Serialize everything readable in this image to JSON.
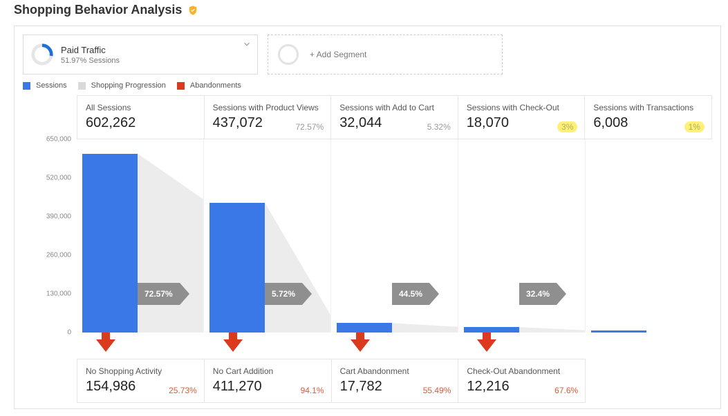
{
  "title": "Shopping Behavior Analysis",
  "segment": {
    "name": "Paid Traffic",
    "sub": "51.97% Sessions"
  },
  "add_segment_label": "+ Add Segment",
  "legend": {
    "sessions": "Sessions",
    "progression": "Shopping Progression",
    "abandon": "Abandonments"
  },
  "axis_ticks": [
    "650,000",
    "520,000",
    "390,000",
    "260,000",
    "130,000",
    "0"
  ],
  "stages": [
    {
      "label": "All Sessions",
      "value": "602,262",
      "pct": "",
      "prog_pct": "72.57%"
    },
    {
      "label": "Sessions with Product Views",
      "value": "437,072",
      "pct": "72.57%",
      "prog_pct": "5.72%"
    },
    {
      "label": "Sessions with Add to Cart",
      "value": "32,044",
      "pct": "5.32%",
      "prog_pct": "44.5%"
    },
    {
      "label": "Sessions with Check-Out",
      "value": "18,070",
      "pct": "3%",
      "highlight": true,
      "prog_pct": "32.4%"
    },
    {
      "label": "Sessions with Transactions",
      "value": "6,008",
      "pct": "1%",
      "highlight": true
    }
  ],
  "dropoffs": [
    {
      "label": "No Shopping Activity",
      "value": "154,986",
      "pct": "25.73%"
    },
    {
      "label": "No Cart Addition",
      "value": "411,270",
      "pct": "94.1%"
    },
    {
      "label": "Cart Abandonment",
      "value": "17,782",
      "pct": "55.49%"
    },
    {
      "label": "Check-Out Abandonment",
      "value": "12,216",
      "pct": "67.6%"
    }
  ],
  "chart_data": {
    "type": "bar",
    "title": "Shopping Behavior Analysis",
    "ylabel": "Sessions",
    "ylim": [
      0,
      650000
    ],
    "categories": [
      "All Sessions",
      "Sessions with Product Views",
      "Sessions with Add to Cart",
      "Sessions with Check-Out",
      "Sessions with Transactions"
    ],
    "values": [
      602262,
      437072,
      32044,
      18070,
      6008
    ],
    "progression_pct": [
      72.57,
      5.72,
      44.5,
      32.4
    ],
    "dropoff_categories": [
      "No Shopping Activity",
      "No Cart Addition",
      "Cart Abandonment",
      "Check-Out Abandonment"
    ],
    "dropoff_values": [
      154986,
      411270,
      17782,
      12216
    ],
    "dropoff_pct": [
      25.73,
      94.1,
      55.49,
      67.6
    ]
  }
}
